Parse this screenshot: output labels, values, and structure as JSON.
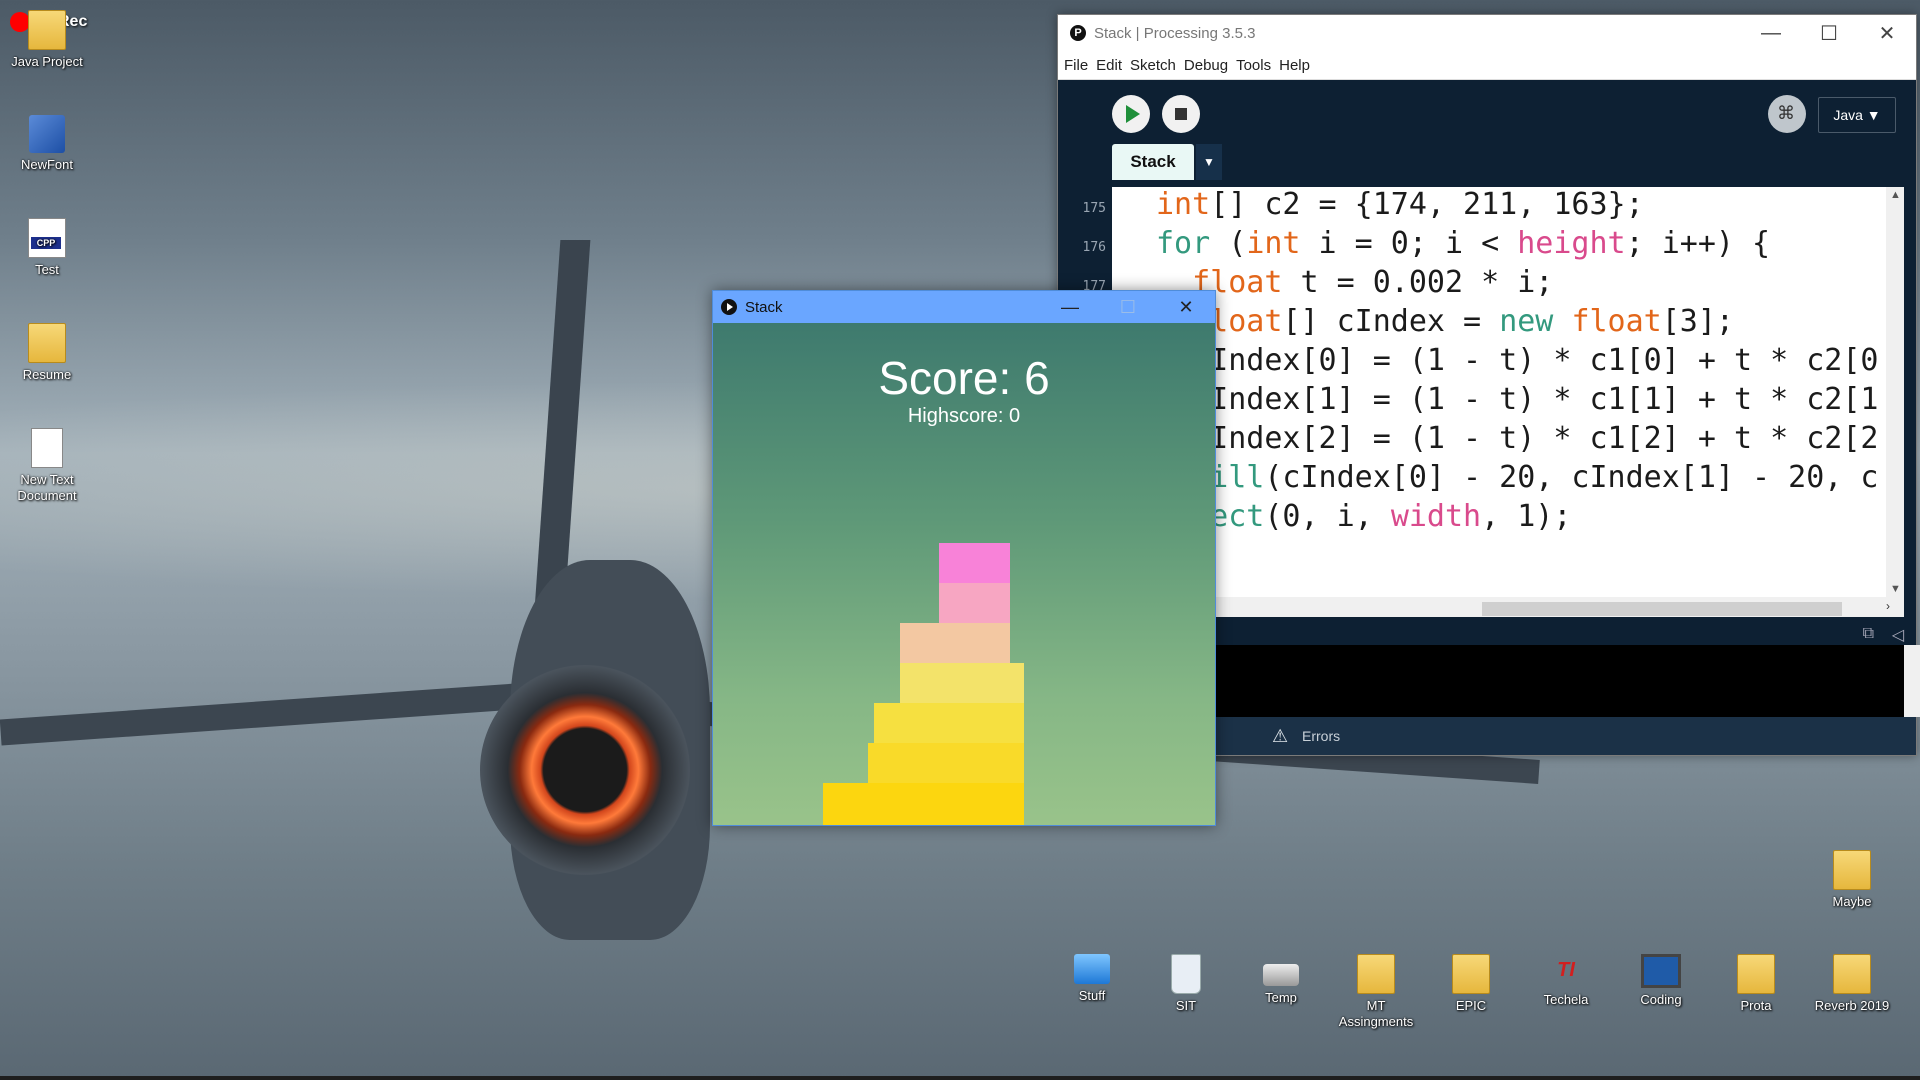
{
  "recording": {
    "label": "Rec",
    "color": "#ff0000"
  },
  "desktop_icons": [
    {
      "label": "Java Project",
      "icon": "folder-icon"
    },
    {
      "label": "NewFont",
      "icon": "font-installer-icon"
    },
    {
      "label": "Test",
      "icon": "cpp-file-icon"
    },
    {
      "label": "Resume",
      "icon": "folder-icon"
    },
    {
      "label": "New Text Document",
      "icon": "text-document-icon"
    },
    {
      "label": "Maybe",
      "icon": "folder-icon"
    },
    {
      "label": "Stuff",
      "icon": "computer-icon"
    },
    {
      "label": "SIT",
      "icon": "recycle-bin-icon"
    },
    {
      "label": "Temp",
      "icon": "drive-icon"
    },
    {
      "label": "MT Assingments",
      "icon": "folder-icon"
    },
    {
      "label": "EPIC",
      "icon": "folder-icon"
    },
    {
      "label": "Techela",
      "icon": "techela-icon"
    },
    {
      "label": "Coding",
      "icon": "monitor-icon"
    },
    {
      "label": "Prota",
      "icon": "folder-icon"
    },
    {
      "label": "Reverb 2019",
      "icon": "folder-icon"
    }
  ],
  "ide": {
    "title": "Stack | Processing 3.5.3",
    "menu": [
      "File",
      "Edit",
      "Sketch",
      "Debug",
      "Tools",
      "Help"
    ],
    "mode": "Java ▼",
    "tab": "Stack",
    "line_numbers": [
      "175",
      "176",
      "177"
    ],
    "code": {
      "l1a": "int",
      "l1b": "[] c2 = {174, 211, 163};",
      "l2a": "for",
      "l2b": " (",
      "l2c": "int",
      "l2d": " i = 0; i < ",
      "l2e": "height",
      "l2f": "; i++) {",
      "l3a": "  float",
      "l3b": " t = 0.002 * i;",
      "l4a": "  float",
      "l4b": "[] cIndex = ",
      "l4c": "new",
      "l4d": " ",
      "l4e": "float",
      "l4f": "[3];",
      "l5": "  cIndex[0] = (1 - t) * c1[0] + t * c2[0",
      "l6": "  cIndex[1] = (1 - t) * c1[1] + t * c2[1",
      "l7": "  cIndex[2] = (1 - t) * c1[2] + t * c2[2",
      "l8a": "  fill",
      "l8b": "(cIndex[0] - 20, cIndex[1] - 20, c",
      "l9a": "  rect",
      "l9b": "(0, i, ",
      "l9c": "width",
      "l9d": ", 1);"
    },
    "errors_tab": "Errors",
    "colors": {
      "background": "#0d2033",
      "keyword_type": "#e2661a",
      "keyword_control": "#33997e",
      "builtin": "#d94a8c"
    }
  },
  "stack_window": {
    "title": "Stack",
    "score": "Score: 6",
    "highscore": "Highscore: 0",
    "blocks": [
      {
        "color": "#fcd60f"
      },
      {
        "color": "#f9da29"
      },
      {
        "color": "#f6e040"
      },
      {
        "color": "#f3e36a"
      },
      {
        "color": "#f3c8a2"
      },
      {
        "color": "#f7a6c2"
      },
      {
        "color": "#f882d8"
      }
    ]
  }
}
